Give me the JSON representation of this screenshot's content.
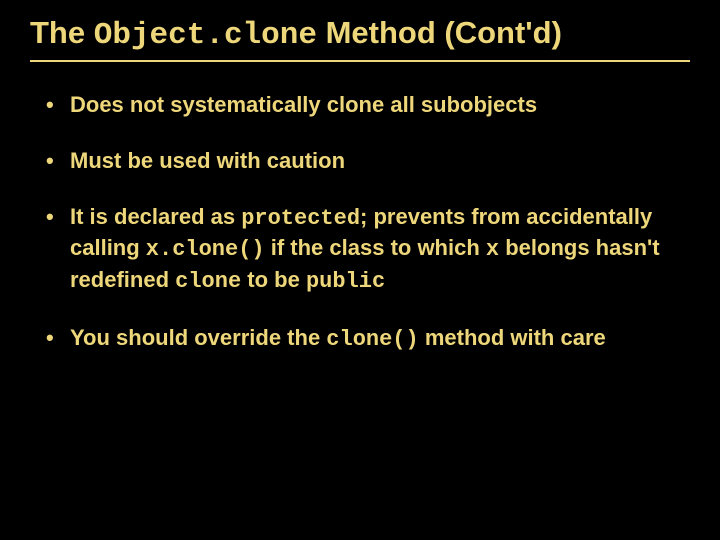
{
  "title": {
    "pre": "The ",
    "code": "Object.clone",
    "post": " Method (Cont'd)"
  },
  "bullets": [
    {
      "full": "Does not systematically clone all subobjects"
    },
    {
      "full": "Must be used with caution"
    },
    {
      "p1": "It is declared as ",
      "c1": "protected",
      "p2": "; prevents from accidentally calling ",
      "c2": "x.clone()",
      "p3": " if the class to which ",
      "c3": "x",
      "p4": " belongs hasn't redefined ",
      "c4": "clone",
      "p5": " to be ",
      "c5": "public"
    },
    {
      "p1": "You should override the ",
      "c1": "clone()",
      "p2": " method with care"
    }
  ]
}
